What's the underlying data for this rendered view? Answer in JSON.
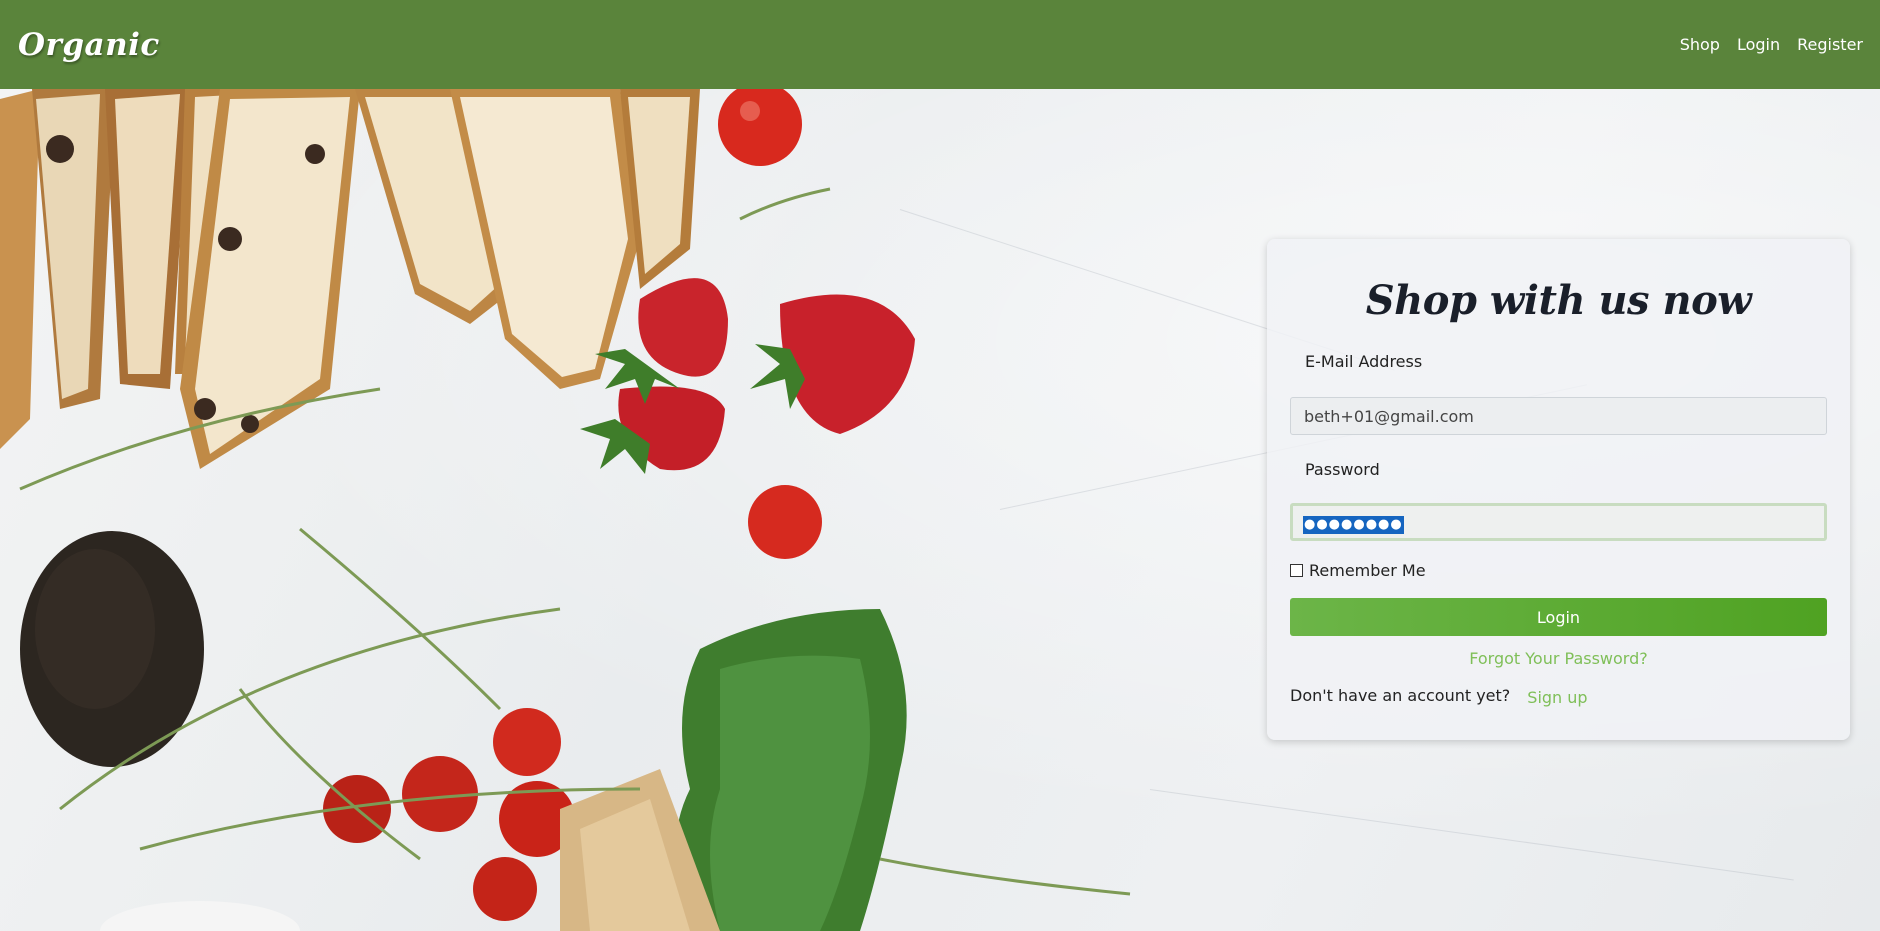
{
  "header": {
    "brand": "Organic",
    "nav": [
      "Shop",
      "Login",
      "Register"
    ]
  },
  "login_form": {
    "title": "Shop with us now",
    "email_label": "E-Mail Address",
    "email_value": "beth+01@gmail.com",
    "password_label": "Password",
    "password_mask": "●●●●●●●●",
    "remember_label": "Remember Me",
    "remember_checked": false,
    "login_button": "Login",
    "forgot_link": "Forgot Your Password?",
    "signup_prompt": "Don't have an account yet?",
    "signup_link": "Sign up"
  },
  "colors": {
    "header_bg": "#5a843b",
    "accent": "#5aab30",
    "link": "#7fbf58"
  }
}
